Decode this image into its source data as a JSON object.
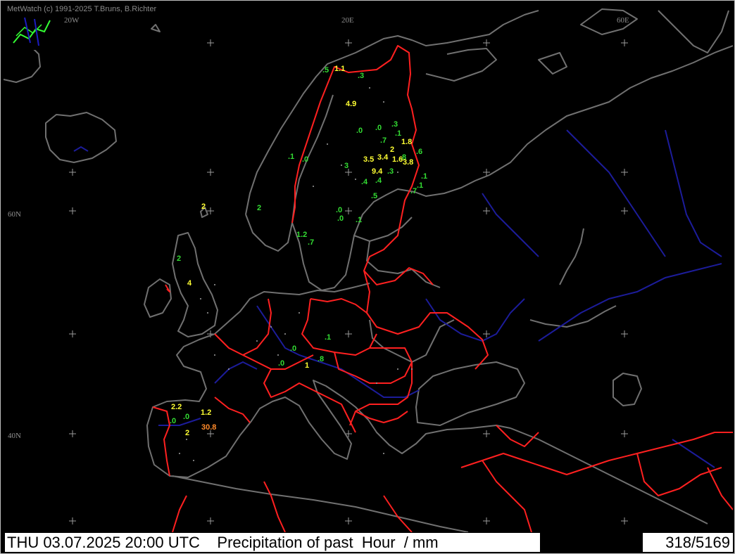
{
  "credit": "MetWatch  (c) 1991-2025 T.Bruns, B.Richter",
  "grid_labels": {
    "lon_20w": "20W",
    "lon_20e": "20E",
    "lon_60e": "60E",
    "lat_60n": "60N",
    "lat_40n": "40N"
  },
  "status": {
    "datetime": "THU 03.07.2025 20:00 UTC",
    "product": "Precipitation of past  Hour  / mm",
    "counter": "318/5169"
  },
  "colors": {
    "background": "#000000",
    "coast": "#707070",
    "borders": "#ff2020",
    "rivers": "#1c1c9a",
    "value_low": "#33dd33",
    "value_mid": "#ffff33",
    "value_high": "#ff8a2a"
  },
  "observations": [
    {
      "v": ".5",
      "c": "low"
    },
    {
      "v": "1.1",
      "c": "mid"
    },
    {
      "v": ".3",
      "c": "low"
    },
    {
      "v": "4.9",
      "c": "mid"
    },
    {
      "v": ".0",
      "c": "low"
    },
    {
      "v": ".0",
      "c": "low"
    },
    {
      "v": ".3",
      "c": "low"
    },
    {
      "v": ".7",
      "c": "low"
    },
    {
      "v": ".1",
      "c": "low"
    },
    {
      "v": "1.8",
      "c": "mid"
    },
    {
      "v": "2",
      "c": "mid"
    },
    {
      "v": ".6",
      "c": "low"
    },
    {
      "v": ".8",
      "c": "low"
    },
    {
      "v": ".1",
      "c": "low"
    },
    {
      "v": ".0",
      "c": "low"
    },
    {
      "v": "3.5",
      "c": "mid"
    },
    {
      "v": "3.4",
      "c": "mid"
    },
    {
      "v": "1.6",
      "c": "mid"
    },
    {
      "v": "3.8",
      "c": "mid"
    },
    {
      "v": "3",
      "c": "low"
    },
    {
      "v": "9.4",
      "c": "mid"
    },
    {
      "v": ".3",
      "c": "low"
    },
    {
      "v": ".1",
      "c": "low"
    },
    {
      "v": ".4",
      "c": "low"
    },
    {
      "v": ".4",
      "c": "low"
    },
    {
      "v": ".1",
      "c": "low"
    },
    {
      "v": ".5",
      "c": "low"
    },
    {
      "v": ".7",
      "c": "low"
    },
    {
      "v": "2",
      "c": "mid"
    },
    {
      "v": "2",
      "c": "low"
    },
    {
      "v": ".0",
      "c": "low"
    },
    {
      "v": ".0",
      "c": "low"
    },
    {
      "v": ".1",
      "c": "low"
    },
    {
      "v": "1.2",
      "c": "low"
    },
    {
      "v": ".7",
      "c": "low"
    },
    {
      "v": "2",
      "c": "low"
    },
    {
      "v": "4",
      "c": "mid"
    },
    {
      "v": ".1",
      "c": "low"
    },
    {
      "v": ".0",
      "c": "low"
    },
    {
      "v": ".8",
      "c": "low"
    },
    {
      "v": "1",
      "c": "mid"
    },
    {
      "v": ".0",
      "c": "low"
    },
    {
      "v": "2.2",
      "c": "mid"
    },
    {
      "v": ".0",
      "c": "low"
    },
    {
      "v": "1.2",
      "c": "mid"
    },
    {
      "v": ".0",
      "c": "low"
    },
    {
      "v": "30.8",
      "c": "high"
    },
    {
      "v": "2",
      "c": "mid"
    }
  ]
}
